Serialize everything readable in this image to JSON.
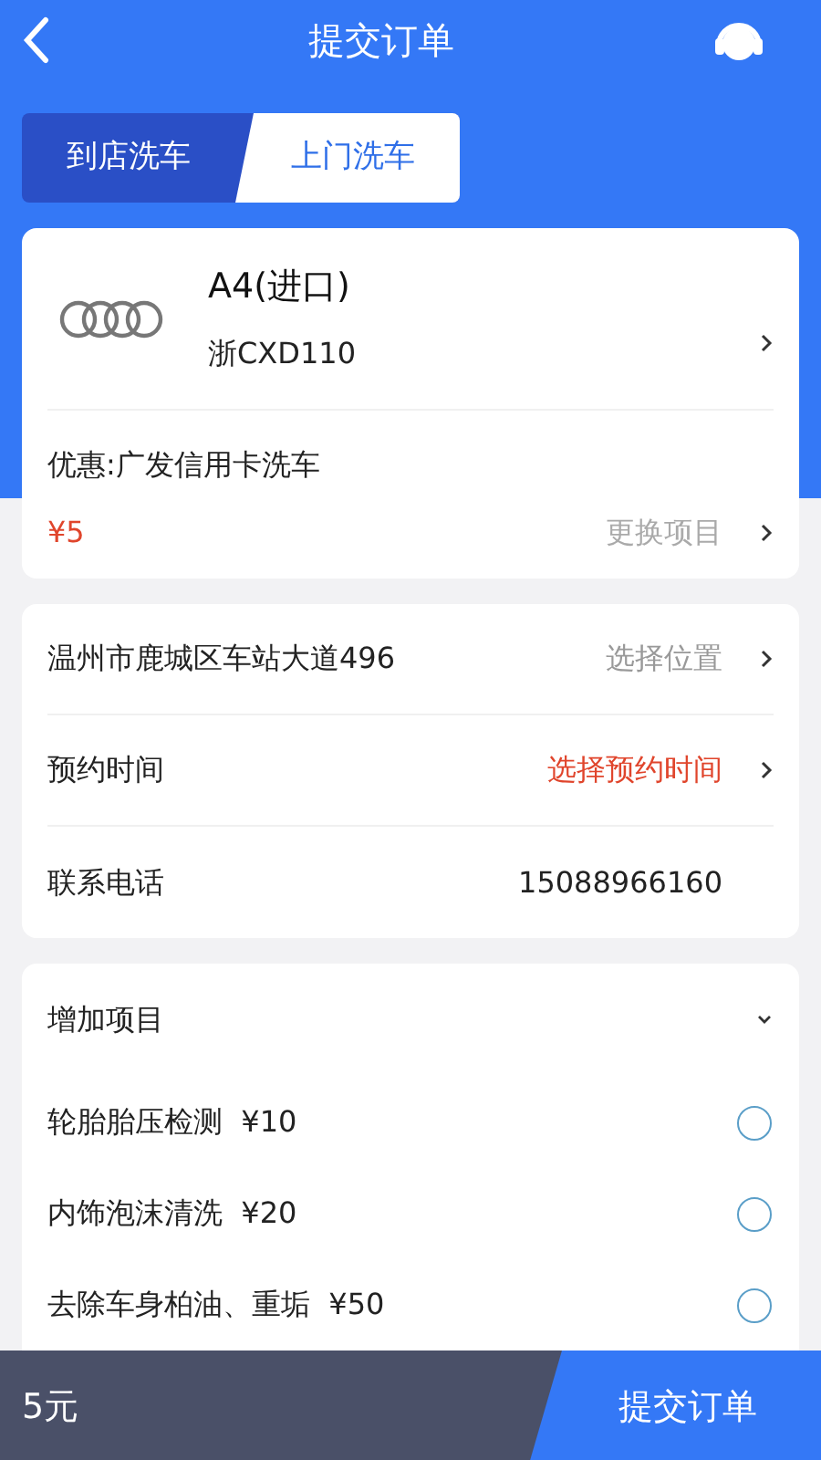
{
  "header": {
    "title": "提交订单"
  },
  "tabs": [
    {
      "label": "到店洗车",
      "selected": false
    },
    {
      "label": "上门洗车",
      "selected": true
    }
  ],
  "vehicle": {
    "model": "A4(进口)",
    "plate": "浙CXD110"
  },
  "discount": {
    "label": "优惠:广发信用卡洗车",
    "price": "¥5",
    "action": "更换项目"
  },
  "details": [
    {
      "label": "温州市鹿城区车站大道496",
      "value": "选择位置",
      "kind": "link"
    },
    {
      "label": "预约时间",
      "value": "选择预约时间",
      "kind": "alert"
    },
    {
      "label": "联系电话",
      "value": "15088966160",
      "kind": "plain"
    }
  ],
  "extras": {
    "title": "增加项目",
    "expanded": true,
    "items": [
      {
        "label": "轮胎胎压检测  ¥10",
        "selected": false
      },
      {
        "label": "内饰泡沫清洗  ¥20",
        "selected": false
      },
      {
        "label": "去除车身柏油、重垢  ¥50",
        "selected": false
      }
    ]
  },
  "footer": {
    "total": "5元",
    "submit": "提交订单"
  }
}
